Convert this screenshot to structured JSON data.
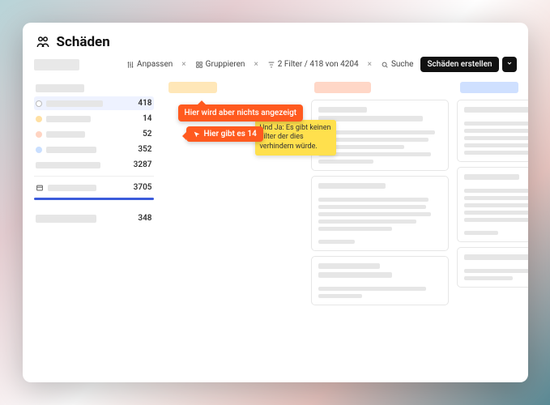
{
  "header": {
    "title": "Schäden"
  },
  "toolbar": {
    "customize": "Anpassen",
    "group": "Gruppieren",
    "filter": "2 Filter / 418 von 4204",
    "search": "Suche",
    "create": "Schäden erstellen"
  },
  "sidebar": {
    "items": [
      {
        "count": "418",
        "selected": true,
        "dotBorder": "#bbb"
      },
      {
        "count": "14",
        "dot": "#ffe0a3"
      },
      {
        "count": "52",
        "dot": "#ffd4c2"
      },
      {
        "count": "352",
        "dot": "#c9dfff"
      }
    ],
    "sum1": "3287",
    "sum2": "3705",
    "footer_count": "348"
  },
  "columns": {
    "a": {
      "color": "#ffe7b8"
    },
    "b": {
      "color": "#ffd7c7"
    },
    "c": {
      "color": "#cfe0ff"
    }
  },
  "callouts": {
    "empty": "Hier wird aber nichts angezeigt",
    "count": "Hier gibt es 14",
    "note": "Und Ja: Es gibt keinen Filter der dies verhindern würde."
  }
}
